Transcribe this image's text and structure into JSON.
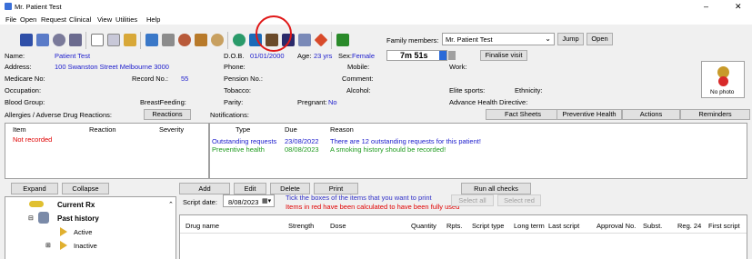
{
  "window": {
    "title": "Mr. Patient Test",
    "minimize": "–",
    "close": "✕"
  },
  "menu": [
    "File",
    "Open",
    "Request",
    "Clinical",
    "View",
    "Utilities",
    "Help"
  ],
  "toolbar": {
    "family_label": "Family members:",
    "family_value": "Mr. Patient Test",
    "jump": "Jump",
    "open": "Open",
    "timer": "7m 51s",
    "finalise": "Finalise visit"
  },
  "patient": {
    "name_label": "Name:",
    "name": "Patient Test",
    "address_label": "Address:",
    "address": "100 Swanston Street Melbourne 3000",
    "medicare_label": "Medicare No:",
    "record_label": "Record No.:",
    "record": "55",
    "occupation_label": "Occupation:",
    "blood_label": "Blood Group:",
    "breastfeeding_label": "BreastFeeding:",
    "dob_label": "D.O.B.",
    "dob": "01/01/2000",
    "age_label": "Age:",
    "age": "23 yrs",
    "sex_label": "Sex:",
    "sex": "Female",
    "phone_label": "Phone:",
    "pension_label": "Pension No.:",
    "tobacco_label": "Tobacco:",
    "parity_label": "Parity:",
    "pregnant_label": "Pregnant:",
    "pregnant": "No",
    "mobile_label": "Mobile:",
    "comment_label": "Comment:",
    "alcohol_label": "Alcohol:",
    "work_label": "Work:",
    "elite_label": "Elite sports:",
    "ethnicity_label": "Ethnicity:",
    "directive_label": "Advance Health Directive:",
    "photo_label": "No photo"
  },
  "allergies": {
    "title": "Allergies / Adverse Drug Reactions:",
    "reactions_btn": "Reactions",
    "cols": [
      "Item",
      "Reaction",
      "Severity"
    ],
    "value": "Not recorded"
  },
  "notifications": {
    "title": "Notifications:",
    "tabs": [
      "Fact Sheets",
      "Preventive Health",
      "Actions",
      "Reminders"
    ],
    "cols": [
      "Type",
      "Due",
      "Reason"
    ],
    "rows": [
      {
        "type": "Outstanding requests",
        "due": "23/08/2022",
        "reason": "There are 12 outstanding requests for this patient!"
      },
      {
        "type": "Preventive health",
        "due": "08/08/2023",
        "reason": "A smoking history should be recorded!"
      }
    ]
  },
  "tree": {
    "expand": "Expand",
    "collapse": "Collapse",
    "items": [
      "Current Rx",
      "Past history",
      "Active",
      "Inactive"
    ]
  },
  "rx": {
    "add": "Add",
    "edit": "Edit",
    "delete": "Delete",
    "print": "Print",
    "run_checks": "Run all checks",
    "script_date_label": "Script date:",
    "script_date": "8/08/2023",
    "hint1": "Tick the boxes of the items that you want to print",
    "hint2": "Items in red have been calculated to have been fully used",
    "select_all": "Select all",
    "select_red": "Select red",
    "cols": [
      "Drug name",
      "Strength",
      "Dose",
      "Quantity",
      "Rpts.",
      "Script type",
      "Long term",
      "Last script",
      "Approval No.",
      "Subst.",
      "Reg. 24",
      "First script"
    ]
  }
}
